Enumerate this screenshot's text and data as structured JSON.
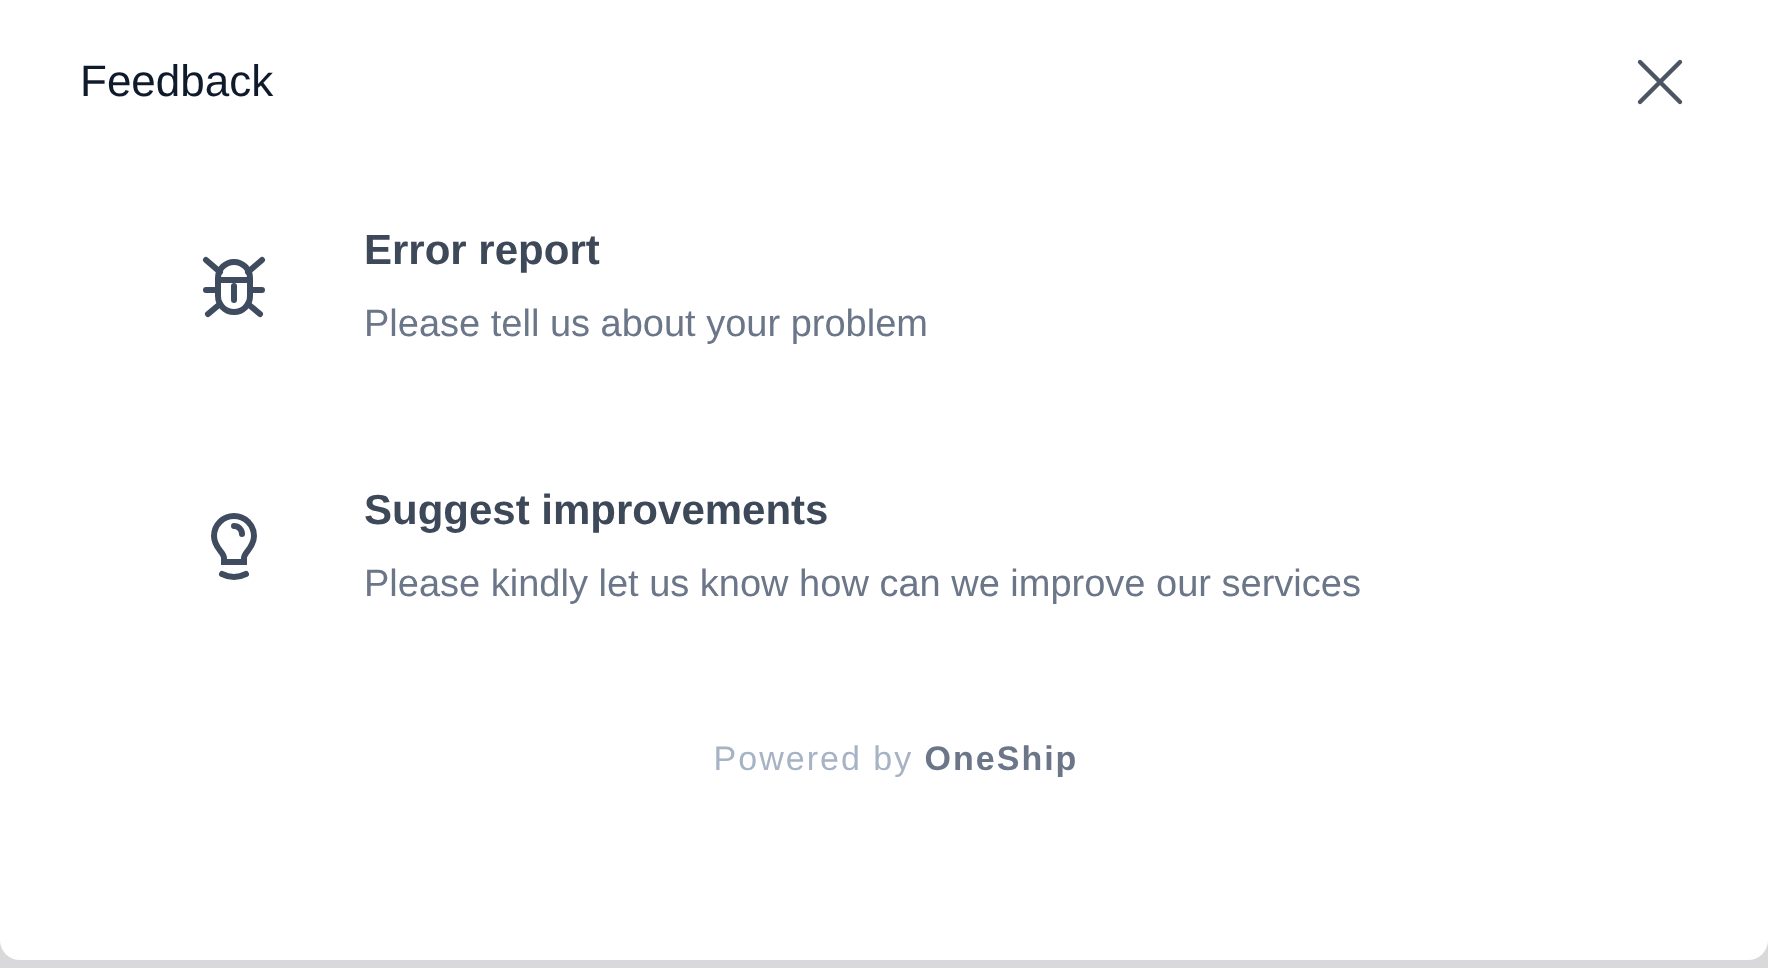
{
  "dialog": {
    "title": "Feedback"
  },
  "options": [
    {
      "kind": "bug",
      "title": "Error report",
      "description": "Please tell us about your problem"
    },
    {
      "kind": "bulb",
      "title": "Suggest improvements",
      "description": "Please kindly let us know how can we improve our services"
    }
  ],
  "footer": "Powered by **OneShip**"
}
